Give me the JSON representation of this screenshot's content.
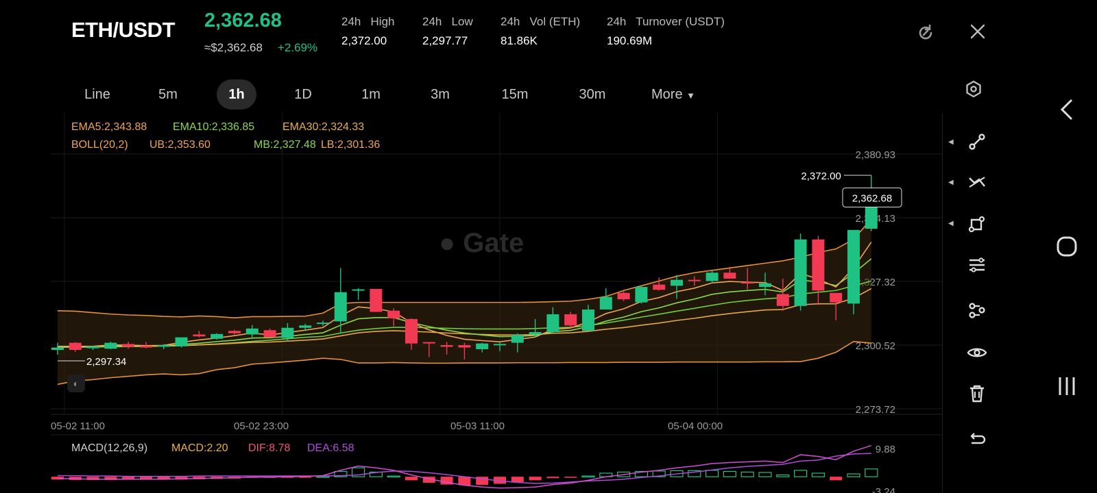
{
  "header": {
    "pair": "ETH/USDT",
    "price": "2,362.68",
    "usd_price": "≈$2,362.68",
    "change": "+2.69%",
    "stats": [
      {
        "label": "24h   High",
        "value": "2,372.00"
      },
      {
        "label": "24h   Low",
        "value": "2,297.77"
      },
      {
        "label": "24h   Vol (ETH)",
        "value": "81.86K"
      },
      {
        "label": "24h   Turnover (USDT)",
        "value": "190.69M"
      }
    ]
  },
  "timeframes": [
    "Line",
    "5m",
    "1h",
    "1D",
    "1m",
    "3m",
    "15m",
    "30m",
    "More"
  ],
  "active_timeframe": "1h",
  "indicators": {
    "ema5": "EMA5:2,343.88",
    "ema10": "EMA10:2,336.85",
    "ema30": "EMA30:2,324.33",
    "boll": "BOLL(20,2)",
    "ub": "UB:2,353.60",
    "mb": "MB:2,327.48",
    "lb": "LB:2,301.36"
  },
  "watermark": "Gate",
  "price_axis": [
    "2,380.93",
    "2,354.13",
    "2,327.32",
    "2,300.52",
    "2,273.72"
  ],
  "time_axis": [
    "05-02 11:00",
    "05-02 23:00",
    "05-03 11:00",
    "05-04 00:00"
  ],
  "high_marker": "2,372.00",
  "low_marker": "2,297.34",
  "last_price_tag": "2,362.68",
  "macd": {
    "title": "MACD(12,26,9)",
    "macd": "MACD:2.20",
    "dif": "DIF:8.78",
    "dea": "DEA:6.58",
    "axis_top": "9.88",
    "axis_bottom": "-3.24"
  },
  "colors": {
    "up": "#1fc283",
    "down": "#f23a55",
    "ema5": "#f0a35a",
    "ema10": "#8ad84a",
    "ema30": "#e8b04a",
    "band": "#3a2a12",
    "dif": "#d24fd1",
    "dea": "#b04dd8"
  },
  "chart_data": {
    "type": "candlestick",
    "interval": "1h",
    "ylim": [
      2273.72,
      2380.93
    ],
    "candles": [
      [
        2298.5,
        2301.5,
        2296.5,
        2299.5
      ],
      [
        2301.5,
        2301.8,
        2297.7,
        2298.5
      ],
      [
        2299.2,
        2300.2,
        2298.5,
        2300.0
      ],
      [
        2299.0,
        2302.0,
        2298.8,
        2301.5
      ],
      [
        2301.0,
        2302.0,
        2299.0,
        2299.8
      ],
      [
        2300.2,
        2301.8,
        2299.2,
        2299.5
      ],
      [
        2299.8,
        2301.0,
        2298.8,
        2300.5
      ],
      [
        2300.0,
        2303.5,
        2299.5,
        2303.8
      ],
      [
        2305.0,
        2306.5,
        2303.8,
        2304.2
      ],
      [
        2303.2,
        2305.5,
        2302.8,
        2305.2
      ],
      [
        2306.5,
        2307.0,
        2305.0,
        2305.5
      ],
      [
        2305.0,
        2309.0,
        2303.8,
        2307.5
      ],
      [
        2306.8,
        2307.5,
        2304.2,
        2303.8
      ],
      [
        2303.5,
        2309.8,
        2302.0,
        2307.8
      ],
      [
        2307.8,
        2309.5,
        2306.5,
        2308.8
      ],
      [
        2309.5,
        2310.8,
        2308.5,
        2310.0
      ],
      [
        2310.5,
        2333.0,
        2305.5,
        2322.8
      ],
      [
        2323.5,
        2324.5,
        2319.5,
        2324.0
      ],
      [
        2324.2,
        2323.8,
        2315.0,
        2314.5
      ],
      [
        2315.0,
        2316.0,
        2308.5,
        2311.8
      ],
      [
        2311.5,
        2311.8,
        2298.5,
        2301.2
      ],
      [
        2301.8,
        2301.5,
        2295.5,
        2301.2
      ],
      [
        2300.5,
        2301.8,
        2296.5,
        2299.8
      ],
      [
        2300.5,
        2301.5,
        2294.5,
        2299.5
      ],
      [
        2298.8,
        2301.5,
        2297.5,
        2301.2
      ],
      [
        2300.5,
        2301.8,
        2298.0,
        2301.0
      ],
      [
        2301.5,
        2305.5,
        2297.5,
        2304.8
      ],
      [
        2305.0,
        2311.5,
        2303.8,
        2306.0
      ],
      [
        2306.0,
        2316.5,
        2305.5,
        2313.5
      ],
      [
        2313.5,
        2314.5,
        2307.5,
        2308.8
      ],
      [
        2306.5,
        2317.5,
        2306.5,
        2315.5
      ],
      [
        2315.5,
        2324.5,
        2315.5,
        2320.8
      ],
      [
        2322.5,
        2323.2,
        2319.0,
        2319.8
      ],
      [
        2318.5,
        2325.5,
        2318.0,
        2325.0
      ],
      [
        2326.0,
        2329.0,
        2323.5,
        2323.8
      ],
      [
        2325.5,
        2330.0,
        2320.0,
        2328.0
      ],
      [
        2328.0,
        2329.5,
        2325.5,
        2327.5
      ],
      [
        2327.5,
        2332.0,
        2326.5,
        2331.0
      ],
      [
        2331.0,
        2333.5,
        2328.5,
        2328.5
      ],
      [
        2327.0,
        2333.0,
        2324.0,
        2326.5
      ],
      [
        2325.0,
        2331.0,
        2321.5,
        2326.5
      ],
      [
        2322.0,
        2328.5,
        2315.0,
        2317.0
      ],
      [
        2317.0,
        2347.5,
        2315.0,
        2345.0
      ],
      [
        2345.0,
        2346.5,
        2317.5,
        2323.5
      ],
      [
        2322.5,
        2322.0,
        2311.0,
        2318.5
      ],
      [
        2318.0,
        2347.0,
        2313.5,
        2349.0
      ],
      [
        2349.5,
        2372.0,
        2348.5,
        2362.68
      ]
    ],
    "ema5": [
      2300.0,
      2299.8,
      2300.0,
      2300.6,
      2300.5,
      2300.3,
      2300.4,
      2301.7,
      2302.7,
      2303.5,
      2304.5,
      2305.6,
      2304.8,
      2305.8,
      2306.8,
      2307.9,
      2312.9,
      2316.6,
      2315.9,
      2314.5,
      2309.9,
      2306.9,
      2304.6,
      2303.0,
      2302.4,
      2301.9,
      2302.9,
      2303.9,
      2307.1,
      2307.7,
      2310.3,
      2313.8,
      2315.8,
      2318.9,
      2320.5,
      2323.0,
      2324.5,
      2326.7,
      2327.3,
      2327.0,
      2326.8,
      2323.5,
      2330.7,
      2328.3,
      2325.0,
      2333.0,
      2343.88
    ],
    "ema10": [
      2300.0,
      2299.9,
      2300.0,
      2300.2,
      2300.2,
      2300.2,
      2300.2,
      2300.8,
      2301.3,
      2302.0,
      2302.6,
      2303.5,
      2303.6,
      2304.2,
      2305.0,
      2305.7,
      2308.9,
      2311.6,
      2312.1,
      2312.1,
      2310.0,
      2308.3,
      2306.8,
      2305.6,
      2304.8,
      2304.1,
      2304.2,
      2304.6,
      2306.2,
      2306.7,
      2308.3,
      2310.6,
      2312.3,
      2314.6,
      2316.2,
      2318.3,
      2319.9,
      2321.9,
      2322.9,
      2323.5,
      2324.0,
      2322.9,
      2327.8,
      2327.2,
      2325.6,
      2330.8,
      2336.85
    ],
    "ema30": [
      2300.0,
      2300.0,
      2300.0,
      2300.1,
      2300.1,
      2300.1,
      2300.1,
      2300.3,
      2300.6,
      2300.9,
      2301.3,
      2301.7,
      2301.8,
      2302.2,
      2302.6,
      2303.1,
      2304.4,
      2305.7,
      2306.3,
      2306.6,
      2306.3,
      2306.0,
      2305.6,
      2305.3,
      2305.0,
      2304.8,
      2304.8,
      2304.9,
      2305.5,
      2305.7,
      2306.3,
      2307.2,
      2307.9,
      2308.9,
      2309.8,
      2310.9,
      2311.8,
      2312.9,
      2313.8,
      2314.6,
      2315.3,
      2315.5,
      2317.5,
      2317.9,
      2317.9,
      2320.3,
      2324.33
    ],
    "boll_ub": [
      2315.0,
      2314.8,
      2314.2,
      2313.6,
      2313.2,
      2313.0,
      2312.6,
      2312.4,
      2312.8,
      2312.5,
      2312.0,
      2312.5,
      2312.5,
      2312.6,
      2312.7,
      2314.0,
      2318.0,
      2318.5,
      2318.5,
      2318.5,
      2318.5,
      2318.5,
      2318.5,
      2318.5,
      2318.5,
      2318.5,
      2318.5,
      2318.6,
      2318.8,
      2319.0,
      2319.8,
      2321.0,
      2323.5,
      2325.5,
      2327.5,
      2329.5,
      2331.0,
      2332.0,
      2333.0,
      2334.0,
      2335.0,
      2336.0,
      2337.5,
      2339.5,
      2341.0,
      2345.0,
      2353.6
    ],
    "boll_mb": [
      2299.6,
      2299.6,
      2299.7,
      2299.8,
      2299.9,
      2300.0,
      2300.1,
      2300.3,
      2300.6,
      2301.0,
      2301.5,
      2302.1,
      2302.6,
      2303.2,
      2303.8,
      2304.2,
      2305.6,
      2306.8,
      2307.5,
      2308.0,
      2308.0,
      2307.8,
      2307.6,
      2307.4,
      2307.3,
      2307.3,
      2307.3,
      2307.5,
      2307.8,
      2308.0,
      2308.8,
      2309.8,
      2311.0,
      2312.3,
      2313.5,
      2314.8,
      2316.0,
      2317.3,
      2318.5,
      2319.3,
      2320.0,
      2320.5,
      2322.0,
      2322.8,
      2323.5,
      2325.5,
      2327.48
    ],
    "boll_lb": [
      2284.0,
      2285.4,
      2286.0,
      2286.8,
      2287.4,
      2288.0,
      2288.4,
      2288.0,
      2288.5,
      2290.2,
      2291.0,
      2292.5,
      2293.0,
      2293.6,
      2294.2,
      2295.0,
      2294.5,
      2293.0,
      2293.0,
      2293.2,
      2293.0,
      2292.9,
      2292.9,
      2293.0,
      2293.0,
      2293.0,
      2293.1,
      2293.1,
      2293.1,
      2293.2,
      2293.2,
      2293.2,
      2293.3,
      2293.3,
      2293.3,
      2293.4,
      2293.4,
      2293.4,
      2293.4,
      2293.4,
      2293.5,
      2293.5,
      2293.6,
      2295.0,
      2297.5,
      2302.0,
      2301.36
    ],
    "macd": {
      "hist": [
        -0.8,
        -0.9,
        -0.9,
        -0.9,
        -0.8,
        -0.8,
        -0.8,
        -0.8,
        -0.7,
        -0.6,
        -0.5,
        -0.3,
        -0.3,
        -0.2,
        -0.1,
        0.1,
        1.5,
        2.5,
        1.3,
        0.2,
        -1.0,
        -1.7,
        -2.2,
        -2.4,
        -2.3,
        -2.0,
        -1.5,
        -1.0,
        -0.4,
        -0.3,
        0.2,
        1.0,
        1.3,
        1.5,
        1.6,
        1.7,
        1.7,
        1.8,
        1.5,
        1.3,
        1.2,
        0.5,
        1.8,
        1.0,
        -1.0,
        0.8,
        2.2
      ],
      "dif": [
        -0.5,
        -0.6,
        -0.7,
        -0.7,
        -0.7,
        -0.7,
        -0.7,
        -0.6,
        -0.5,
        -0.4,
        -0.3,
        -0.1,
        -0.1,
        0.0,
        0.1,
        0.3,
        1.8,
        3.0,
        2.5,
        1.8,
        0.5,
        -0.6,
        -1.6,
        -2.4,
        -2.9,
        -3.2,
        -3.1,
        -2.9,
        -2.2,
        -1.8,
        -1.0,
        0.0,
        0.6,
        1.3,
        1.8,
        2.5,
        3.0,
        3.7,
        4.0,
        4.2,
        4.4,
        4.0,
        6.2,
        5.7,
        4.8,
        7.2,
        8.78
      ],
      "dea": [
        0.3,
        0.3,
        0.2,
        0.2,
        0.1,
        0.1,
        0.1,
        0.1,
        0.2,
        0.2,
        0.2,
        0.2,
        0.2,
        0.2,
        0.2,
        0.2,
        0.3,
        0.5,
        1.2,
        1.6,
        1.5,
        1.1,
        0.6,
        0.0,
        -0.6,
        -1.2,
        -1.6,
        -1.9,
        -1.8,
        -1.5,
        -1.2,
        -1.0,
        -0.7,
        -0.2,
        0.2,
        0.8,
        1.3,
        1.9,
        2.5,
        2.9,
        3.2,
        3.5,
        4.4,
        4.7,
        5.8,
        6.4,
        6.58
      ]
    }
  }
}
